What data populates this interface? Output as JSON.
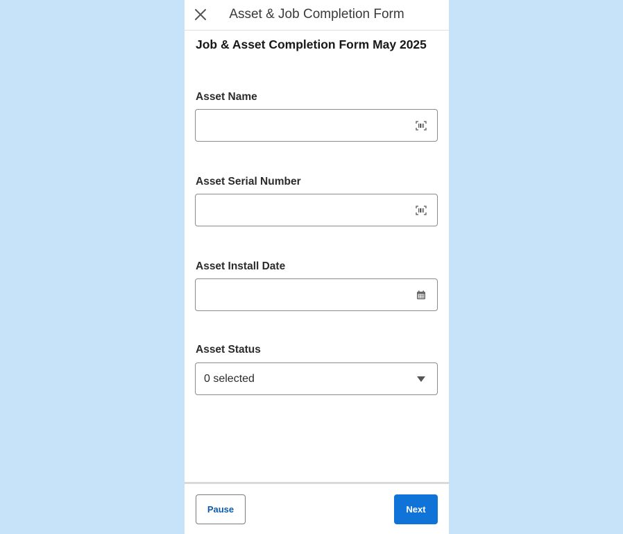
{
  "header": {
    "title": "Asset & Job Completion Form",
    "close_icon": "close-icon"
  },
  "form": {
    "title": "Job & Asset Completion Form May 2025",
    "fields": [
      {
        "label": "Asset Name",
        "value": "",
        "icon": "barcode-scan-icon"
      },
      {
        "label": "Asset Serial Number",
        "value": "",
        "icon": "barcode-scan-icon"
      },
      {
        "label": "Asset Install Date",
        "value": "",
        "icon": "calendar-icon"
      },
      {
        "label": "Asset Status",
        "value": "0 selected",
        "icon": "chevron-down-icon"
      }
    ]
  },
  "footer": {
    "pause_label": "Pause",
    "next_label": "Next"
  },
  "colors": {
    "background": "#c7e3f9",
    "primary": "#0f73d8",
    "link": "#0b5cab"
  }
}
